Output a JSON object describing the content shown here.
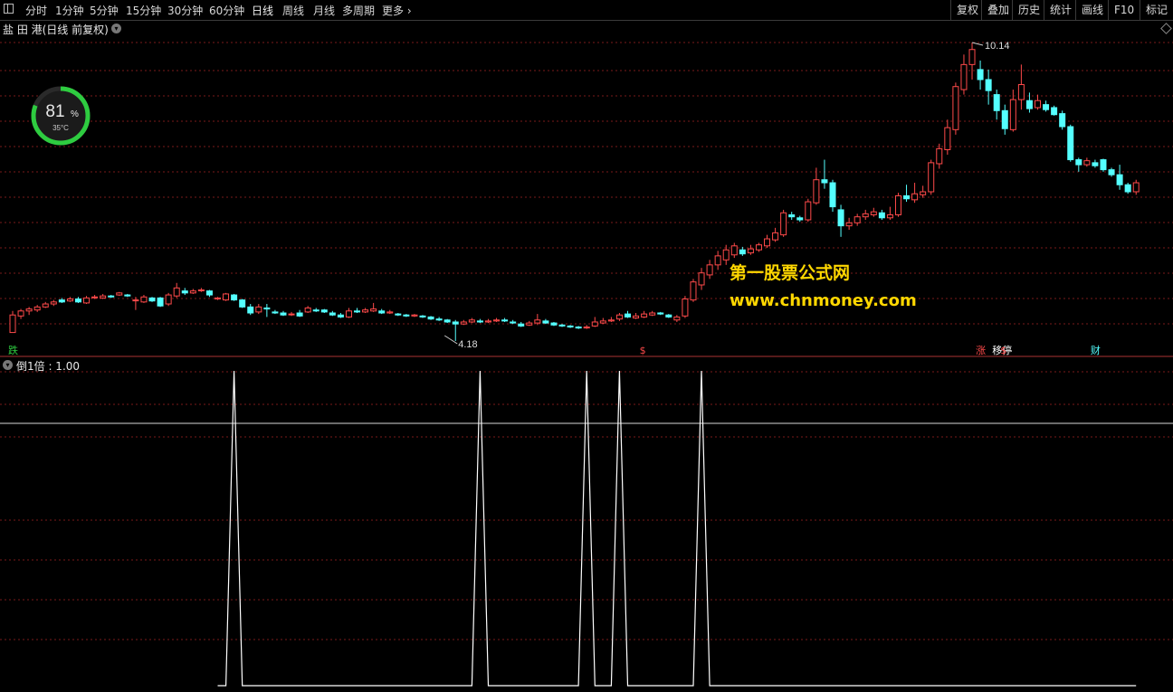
{
  "toolbar": {
    "periods": [
      "分时",
      "1分钟",
      "5分钟",
      "15分钟",
      "30分钟",
      "60分钟",
      "日线",
      "周线",
      "月线",
      "多周期",
      "更多"
    ],
    "active_period": "日线",
    "more_arrow": "›",
    "right_buttons": [
      "复权",
      "叠加",
      "历史",
      "统计",
      "画线",
      "F10",
      "标记"
    ]
  },
  "stock_title": "盐 田 港(日线 前复权)",
  "gauge": {
    "percent": "81",
    "percent_sign": "%",
    "temp": "35°C",
    "color": "#2ecc40"
  },
  "indicator_label": "倒1倍 : 1.00",
  "watermark": {
    "line1": "第一股票公式网",
    "line2": "www.chnmoney.com"
  },
  "colors": {
    "up": "#ff4a4a",
    "down": "#54ffff",
    "grid": "#7a1a1a",
    "line": "#ffffff",
    "accent": "#ffd700"
  },
  "chart_data": [
    {
      "type": "candlestick",
      "title": "盐 田 港(日线 前复权)",
      "max_label": "10.14",
      "min_label": "4.18",
      "candles": [
        [
          4.35,
          4.7,
          4.35,
          4.78
        ],
        [
          4.68,
          4.78,
          4.62,
          4.82
        ],
        [
          4.78,
          4.82,
          4.7,
          4.86
        ],
        [
          4.8,
          4.86,
          4.76,
          4.9
        ],
        [
          4.86,
          4.92,
          4.84,
          4.96
        ],
        [
          4.92,
          4.96,
          4.88,
          5.0
        ],
        [
          5.0,
          4.96,
          4.94,
          5.04
        ],
        [
          4.98,
          5.02,
          4.96,
          5.06
        ],
        [
          5.02,
          4.96,
          4.94,
          5.06
        ],
        [
          4.94,
          5.04,
          4.92,
          5.08
        ],
        [
          5.06,
          5.06,
          5.02,
          5.1
        ],
        [
          5.04,
          5.08,
          5.02,
          5.12
        ],
        [
          5.08,
          5.06,
          5.04,
          5.1
        ],
        [
          5.1,
          5.14,
          5.08,
          5.16
        ],
        [
          5.1,
          5.08,
          5.06,
          5.12
        ],
        [
          5.0,
          5.0,
          4.8,
          5.06
        ],
        [
          4.96,
          5.06,
          4.94,
          5.1
        ],
        [
          5.04,
          4.98,
          4.96,
          5.06
        ],
        [
          5.04,
          4.88,
          4.86,
          5.06
        ],
        [
          4.92,
          5.1,
          4.88,
          5.14
        ],
        [
          5.08,
          5.24,
          5.04,
          5.34
        ],
        [
          5.18,
          5.14,
          5.1,
          5.24
        ],
        [
          5.14,
          5.18,
          5.12,
          5.22
        ],
        [
          5.2,
          5.2,
          5.16,
          5.24
        ],
        [
          5.18,
          5.1,
          5.06,
          5.2
        ],
        [
          5.02,
          5.04,
          5.0,
          5.06
        ],
        [
          5.0,
          5.12,
          4.98,
          5.14
        ],
        [
          5.1,
          5.0,
          4.98,
          5.12
        ],
        [
          5.0,
          4.86,
          4.84,
          5.02
        ],
        [
          4.86,
          4.74,
          4.7,
          4.92
        ],
        [
          4.76,
          4.86,
          4.72,
          4.92
        ],
        [
          4.84,
          4.82,
          4.66,
          4.92
        ],
        [
          4.76,
          4.74,
          4.72,
          4.8
        ],
        [
          4.74,
          4.7,
          4.68,
          4.78
        ],
        [
          4.72,
          4.72,
          4.68,
          4.76
        ],
        [
          4.74,
          4.68,
          4.66,
          4.8
        ],
        [
          4.76,
          4.84,
          4.74,
          4.88
        ],
        [
          4.8,
          4.78,
          4.76,
          4.84
        ],
        [
          4.8,
          4.76,
          4.74,
          4.82
        ],
        [
          4.74,
          4.7,
          4.68,
          4.78
        ],
        [
          4.7,
          4.66,
          4.64,
          4.74
        ],
        [
          4.66,
          4.78,
          4.64,
          4.84
        ],
        [
          4.78,
          4.76,
          4.74,
          4.84
        ],
        [
          4.76,
          4.8,
          4.74,
          4.84
        ],
        [
          4.78,
          4.82,
          4.76,
          4.94
        ],
        [
          4.78,
          4.74,
          4.72,
          4.82
        ],
        [
          4.74,
          4.76,
          4.72,
          4.8
        ],
        [
          4.72,
          4.7,
          4.68,
          4.74
        ],
        [
          4.7,
          4.68,
          4.66,
          4.72
        ],
        [
          4.68,
          4.7,
          4.66,
          4.72
        ],
        [
          4.68,
          4.66,
          4.64,
          4.7
        ],
        [
          4.66,
          4.62,
          4.6,
          4.68
        ],
        [
          4.62,
          4.6,
          4.58,
          4.66
        ],
        [
          4.6,
          4.56,
          4.54,
          4.62
        ],
        [
          4.56,
          4.52,
          4.18,
          4.6
        ],
        [
          4.52,
          4.56,
          4.5,
          4.6
        ],
        [
          4.56,
          4.6,
          4.54,
          4.64
        ],
        [
          4.58,
          4.56,
          4.54,
          4.62
        ],
        [
          4.56,
          4.58,
          4.54,
          4.62
        ],
        [
          4.58,
          4.6,
          4.56,
          4.64
        ],
        [
          4.6,
          4.58,
          4.56,
          4.64
        ],
        [
          4.56,
          4.54,
          4.52,
          4.6
        ],
        [
          4.52,
          4.48,
          4.46,
          4.56
        ],
        [
          4.5,
          4.54,
          4.48,
          4.58
        ],
        [
          4.54,
          4.6,
          4.5,
          4.72
        ],
        [
          4.58,
          4.54,
          4.52,
          4.62
        ],
        [
          4.54,
          4.5,
          4.48,
          4.56
        ],
        [
          4.5,
          4.48,
          4.46,
          4.52
        ],
        [
          4.48,
          4.46,
          4.44,
          4.5
        ],
        [
          4.46,
          4.44,
          4.42,
          4.48
        ],
        [
          4.44,
          4.46,
          4.42,
          4.5
        ],
        [
          4.48,
          4.56,
          4.46,
          4.66
        ],
        [
          4.54,
          4.58,
          4.52,
          4.64
        ],
        [
          4.58,
          4.6,
          4.56,
          4.66
        ],
        [
          4.62,
          4.7,
          4.58,
          4.74
        ],
        [
          4.72,
          4.66,
          4.64,
          4.78
        ],
        [
          4.64,
          4.68,
          4.62,
          4.74
        ],
        [
          4.66,
          4.72,
          4.64,
          4.78
        ],
        [
          4.7,
          4.74,
          4.68,
          4.78
        ],
        [
          4.74,
          4.72,
          4.7,
          4.76
        ],
        [
          4.7,
          4.66,
          4.64,
          4.72
        ],
        [
          4.6,
          4.66,
          4.56,
          4.7
        ],
        [
          4.68,
          5.02,
          4.64,
          5.08
        ],
        [
          5.0,
          5.36,
          4.96,
          5.42
        ],
        [
          5.3,
          5.54,
          5.2,
          5.64
        ],
        [
          5.5,
          5.7,
          5.42,
          5.8
        ],
        [
          5.7,
          5.88,
          5.6,
          5.98
        ],
        [
          5.8,
          6.0,
          5.7,
          6.1
        ],
        [
          5.9,
          6.08,
          5.84,
          6.14
        ],
        [
          6.0,
          5.92,
          5.88,
          6.06
        ],
        [
          5.94,
          6.02,
          5.9,
          6.1
        ],
        [
          6.0,
          6.1,
          5.96,
          6.14
        ],
        [
          6.08,
          6.22,
          6.04,
          6.3
        ],
        [
          6.2,
          6.34,
          6.16,
          6.44
        ],
        [
          6.3,
          6.74,
          6.26,
          6.8
        ],
        [
          6.7,
          6.66,
          6.6,
          6.76
        ],
        [
          6.64,
          6.6,
          6.56,
          6.68
        ],
        [
          6.6,
          6.96,
          6.56,
          7.02
        ],
        [
          6.94,
          7.4,
          6.9,
          7.64
        ],
        [
          7.4,
          7.34,
          7.22,
          7.8
        ],
        [
          7.34,
          6.86,
          6.76,
          7.4
        ],
        [
          6.8,
          6.48,
          6.26,
          6.9
        ],
        [
          6.48,
          6.54,
          6.4,
          6.64
        ],
        [
          6.54,
          6.66,
          6.48,
          6.72
        ],
        [
          6.66,
          6.72,
          6.6,
          6.8
        ],
        [
          6.7,
          6.76,
          6.66,
          6.84
        ],
        [
          6.74,
          6.64,
          6.6,
          6.8
        ],
        [
          6.64,
          6.7,
          6.6,
          6.86
        ],
        [
          6.7,
          7.08,
          6.66,
          7.14
        ],
        [
          7.08,
          7.02,
          6.96,
          7.3
        ],
        [
          7.0,
          7.12,
          6.94,
          7.34
        ],
        [
          7.1,
          7.16,
          7.04,
          7.28
        ],
        [
          7.16,
          7.74,
          7.1,
          7.8
        ],
        [
          7.72,
          8.02,
          7.62,
          8.12
        ],
        [
          8.0,
          8.44,
          7.9,
          8.6
        ],
        [
          8.4,
          9.26,
          8.3,
          9.34
        ],
        [
          9.2,
          9.7,
          9.1,
          9.9
        ],
        [
          9.7,
          10.0,
          9.4,
          10.14
        ],
        [
          9.6,
          9.4,
          9.2,
          9.78
        ],
        [
          9.4,
          9.18,
          8.9,
          9.6
        ],
        [
          9.1,
          8.78,
          8.6,
          9.2
        ],
        [
          8.78,
          8.42,
          8.3,
          8.9
        ],
        [
          8.4,
          9.0,
          8.36,
          9.2
        ],
        [
          9.0,
          9.3,
          8.8,
          9.7
        ],
        [
          8.98,
          8.82,
          8.74,
          9.14
        ],
        [
          8.84,
          8.98,
          8.8,
          9.1
        ],
        [
          8.9,
          8.8,
          8.76,
          8.98
        ],
        [
          8.84,
          8.7,
          8.68,
          8.88
        ],
        [
          8.72,
          8.46,
          8.4,
          8.78
        ],
        [
          8.46,
          7.8,
          7.76,
          8.5
        ],
        [
          7.8,
          7.7,
          7.56,
          7.84
        ],
        [
          7.7,
          7.78,
          7.66,
          7.84
        ],
        [
          7.74,
          7.68,
          7.64,
          7.8
        ],
        [
          7.8,
          7.6,
          7.56,
          7.82
        ],
        [
          7.6,
          7.5,
          7.46,
          7.64
        ],
        [
          7.5,
          7.3,
          7.2,
          7.7
        ],
        [
          7.3,
          7.16,
          7.12,
          7.34
        ],
        [
          7.16,
          7.34,
          7.1,
          7.4
        ]
      ],
      "markers": [
        {
          "text": "跌",
          "index": 0,
          "color": "#2ecc40"
        },
        {
          "text": "$",
          "index": 77,
          "color": "#ff4a4a"
        },
        {
          "text": "涨",
          "index": 118,
          "color": "#ff4a4a"
        },
        {
          "text": "移停",
          "index": 120,
          "color": "#ffffff"
        },
        {
          "text": "$",
          "index": 121,
          "color": "#ff4a4a"
        },
        {
          "text": "财",
          "index": 132,
          "color": "#54ffff"
        }
      ]
    },
    {
      "type": "line",
      "title": "倒1倍",
      "series": [
        {
          "name": "倒1倍",
          "value": 1.0
        }
      ],
      "spikes_at": [
        27,
        57,
        70,
        74,
        84
      ],
      "ylim": [
        0,
        1.2
      ]
    }
  ]
}
